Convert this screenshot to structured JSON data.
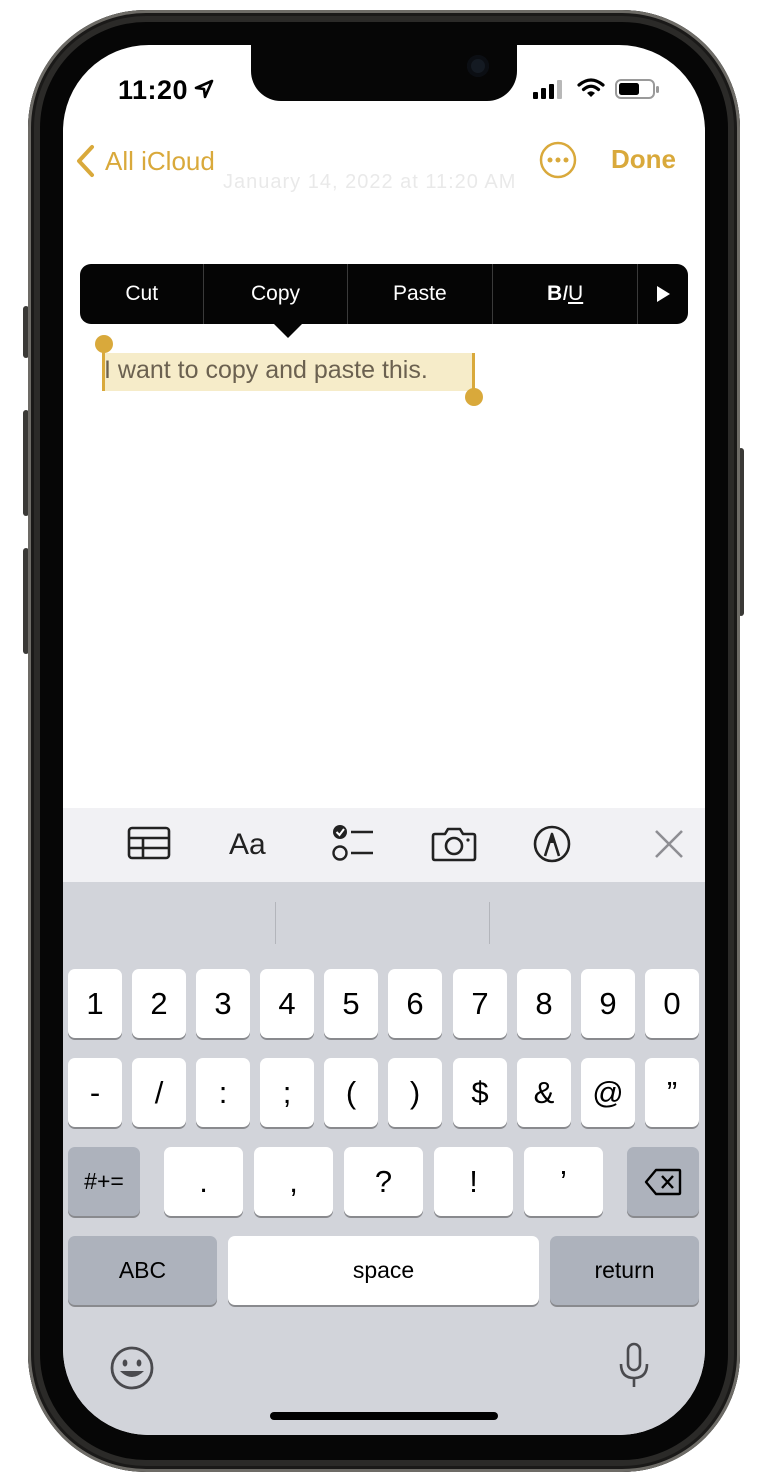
{
  "status_bar": {
    "time": "11:20"
  },
  "nav": {
    "back_label": "All iCloud",
    "done_label": "Done",
    "faded_date": "January 14, 2022 at 11:20 AM"
  },
  "edit_menu": {
    "items": [
      "Cut",
      "Copy",
      "Paste"
    ],
    "format_bold": "B",
    "format_italic": "I",
    "format_underline": "U"
  },
  "note": {
    "text": "I want to copy and paste this."
  },
  "toolbar": {
    "format_label": "Aa",
    "icons": [
      "table-icon",
      "format-icon",
      "checklist-icon",
      "camera-icon",
      "markup-icon",
      "close-icon"
    ]
  },
  "keyboard": {
    "row1": [
      "1",
      "2",
      "3",
      "4",
      "5",
      "6",
      "7",
      "8",
      "9",
      "0"
    ],
    "row2": [
      "-",
      "/",
      ":",
      ";",
      "(",
      ")",
      "$",
      "&",
      "@",
      "”"
    ],
    "row3_mode": "#+=",
    "row3": [
      ".",
      ",",
      "?",
      "!",
      "’"
    ],
    "abc": "ABC",
    "space": "space",
    "return": "return"
  },
  "colors": {
    "accent": "#d9a93b",
    "selection": "#f6ecc9",
    "keyboard_bg": "#d2d4da",
    "menu_bg": "#050505"
  }
}
